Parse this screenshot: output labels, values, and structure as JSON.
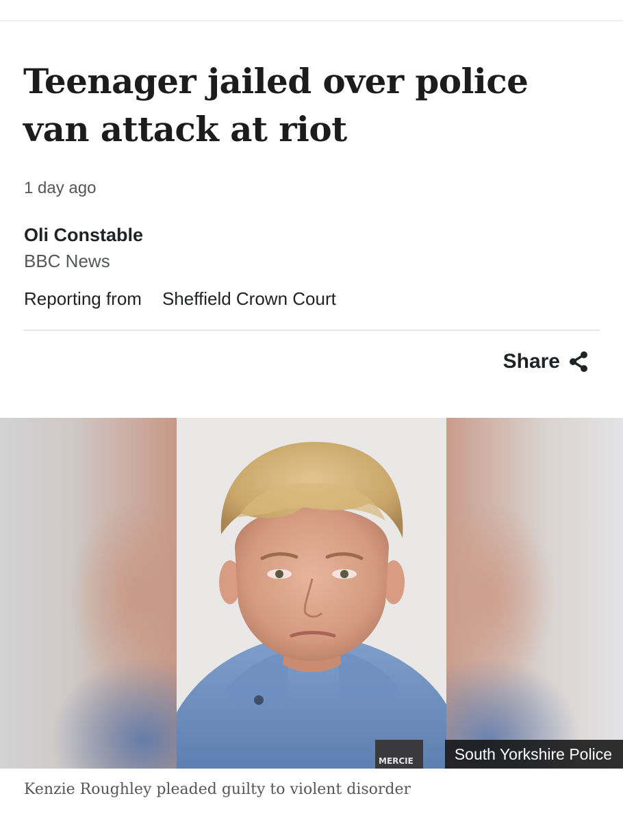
{
  "article": {
    "headline": "Teenager jailed over police van attack at riot",
    "timestamp": "1 day ago",
    "byline": {
      "author": "Oli Constable",
      "organisation": "BBC News",
      "reporting_label": "Reporting from",
      "reporting_location": "Sheffield Crown Court"
    },
    "share_label": "Share",
    "share_icon": "share-icon"
  },
  "image": {
    "credit": "South Yorkshire Police",
    "caption": "Kenzie Roughley pleaded guilty to violent disorder",
    "clothing_text": "MERCIE"
  },
  "colors": {
    "text": "#202224",
    "secondary_text": "#545658",
    "credit_background": "#141414"
  }
}
